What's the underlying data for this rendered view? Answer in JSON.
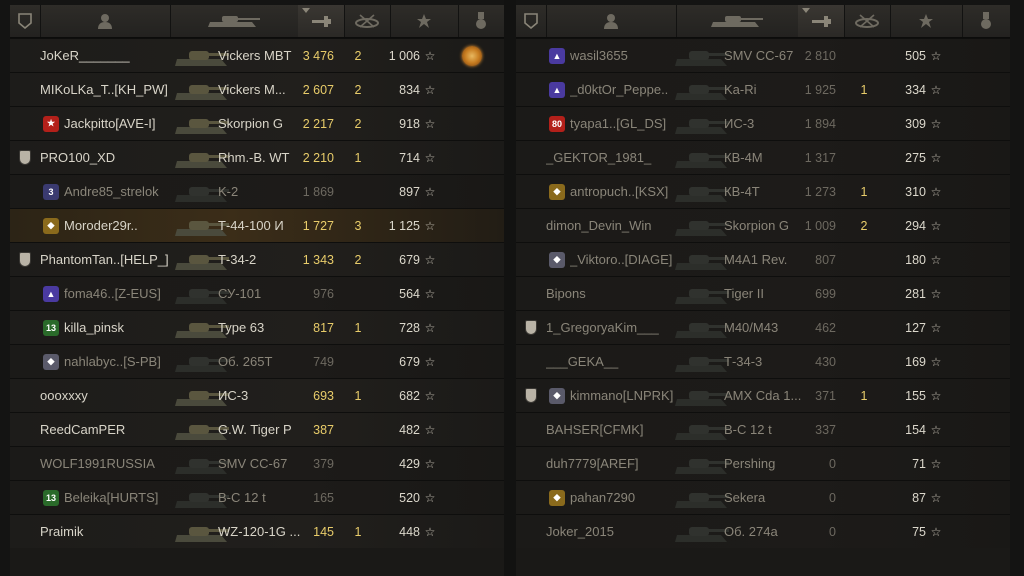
{
  "left_team": {
    "players": [
      {
        "name": "JoKeR_______",
        "tank": "Vickers MBT",
        "dmg": "3 476",
        "kills": "2",
        "xp": "1 006",
        "platoon": false,
        "badge": null,
        "medal": true,
        "dim": false,
        "me": false,
        "dmg_color": "yellow"
      },
      {
        "name": "MIKoLKa_T..[KH_PW]",
        "tank": "Vickers M...",
        "dmg": "2 607",
        "kills": "2",
        "xp": "834",
        "platoon": false,
        "badge": null,
        "medal": false,
        "dim": false,
        "me": false,
        "dmg_color": "yellow"
      },
      {
        "name": "Jackpitto[AVE-I]",
        "tank": "Skorpion G",
        "dmg": "2 217",
        "kills": "2",
        "xp": "918",
        "platoon": false,
        "badge": "star-badge",
        "medal": false,
        "dim": false,
        "me": false,
        "dmg_color": "yellow"
      },
      {
        "name": "PRO100_XD",
        "tank": "Rhm.-B. WT",
        "dmg": "2 210",
        "kills": "1",
        "xp": "714",
        "platoon": true,
        "badge": null,
        "medal": false,
        "dim": false,
        "me": false,
        "dmg_color": "yellow"
      },
      {
        "name": "Andre85_strelok",
        "tank": "K-2",
        "dmg": "1 869",
        "kills": "",
        "xp": "897",
        "platoon": false,
        "badge": "rank-3-badge",
        "medal": false,
        "dim": true,
        "me": false,
        "dmg_color": "grey"
      },
      {
        "name": "Moroder29r..",
        "tank": "Т-44-100 И",
        "dmg": "1 727",
        "kills": "3",
        "xp": "1 125",
        "platoon": false,
        "badge": "gold-badge",
        "medal": false,
        "dim": false,
        "me": true,
        "dmg_color": "yellow"
      },
      {
        "name": "PhantomTan..[HELP_]",
        "tank": "Т-34-2",
        "dmg": "1 343",
        "kills": "2",
        "xp": "679",
        "platoon": true,
        "badge": null,
        "medal": false,
        "dim": false,
        "me": false,
        "dmg_color": "yellow"
      },
      {
        "name": "foma46..[Z-EUS]",
        "tank": "СУ-101",
        "dmg": "976",
        "kills": "",
        "xp": "564",
        "platoon": false,
        "badge": "clan-badge",
        "medal": false,
        "dim": true,
        "me": false,
        "dmg_color": "grey"
      },
      {
        "name": "killa_pinsk",
        "tank": "Type 63",
        "dmg": "817",
        "kills": "1",
        "xp": "728",
        "platoon": false,
        "badge": "rank-13-badge",
        "medal": false,
        "dim": false,
        "me": false,
        "dmg_color": "yellow"
      },
      {
        "name": "nahlabyc..[S-PB]",
        "tank": "Об. 265Т",
        "dmg": "749",
        "kills": "",
        "xp": "679",
        "platoon": false,
        "badge": "diamond-badge",
        "medal": false,
        "dim": true,
        "me": false,
        "dmg_color": "grey"
      },
      {
        "name": "oooxxxy",
        "tank": "ИС-3",
        "dmg": "693",
        "kills": "1",
        "xp": "682",
        "platoon": false,
        "badge": null,
        "medal": false,
        "dim": false,
        "me": false,
        "dmg_color": "yellow"
      },
      {
        "name": "ReedCamPER",
        "tank": "G.W. Tiger P",
        "dmg": "387",
        "kills": "",
        "xp": "482",
        "platoon": false,
        "badge": null,
        "medal": false,
        "dim": false,
        "me": false,
        "dmg_color": "yellow"
      },
      {
        "name": "WOLF1991RUSSIA",
        "tank": "SMV CC-67",
        "dmg": "379",
        "kills": "",
        "xp": "429",
        "platoon": false,
        "badge": null,
        "medal": false,
        "dim": true,
        "me": false,
        "dmg_color": "grey"
      },
      {
        "name": "Beleika[HURTS]",
        "tank": "В-С 12 t",
        "dmg": "165",
        "kills": "",
        "xp": "520",
        "platoon": false,
        "badge": "rank-13-badge",
        "medal": false,
        "dim": true,
        "me": false,
        "dmg_color": "grey"
      },
      {
        "name": "Praimik",
        "tank": "WZ-120-1G ...",
        "dmg": "145",
        "kills": "1",
        "xp": "448",
        "platoon": false,
        "badge": null,
        "medal": false,
        "dim": false,
        "me": false,
        "dmg_color": "yellow"
      }
    ]
  },
  "right_team": {
    "players": [
      {
        "name": "wasil3655",
        "tank": "SMV CC-67",
        "dmg": "2 810",
        "kills": "",
        "xp": "505",
        "platoon": false,
        "badge": "clan-badge",
        "dim": true,
        "dmg_color": "grey"
      },
      {
        "name": "_d0ktOr_Peppe..",
        "tank": "Ka-Ri",
        "dmg": "1 925",
        "kills": "1",
        "xp": "334",
        "platoon": false,
        "badge": "clan-badge",
        "dim": true,
        "dmg_color": "grey"
      },
      {
        "name": "tyapa1..[GL_DS]",
        "tank": "ИС-3",
        "dmg": "1 894",
        "kills": "",
        "xp": "309",
        "platoon": false,
        "badge": "red-badge",
        "dim": true,
        "dmg_color": "grey"
      },
      {
        "name": "_GEKTOR_1981_",
        "tank": "КВ-4М",
        "dmg": "1 317",
        "kills": "",
        "xp": "275",
        "platoon": false,
        "badge": null,
        "dim": true,
        "dmg_color": "grey"
      },
      {
        "name": "antropuch..[KSX]",
        "tank": "КВ-4Т",
        "dmg": "1 273",
        "kills": "1",
        "xp": "310",
        "platoon": false,
        "badge": "gold-badge",
        "dim": true,
        "dmg_color": "grey"
      },
      {
        "name": "dimon_Devin_Win",
        "tank": "Skorpion G",
        "dmg": "1 009",
        "kills": "2",
        "xp": "294",
        "platoon": false,
        "badge": null,
        "dim": true,
        "dmg_color": "grey"
      },
      {
        "name": "_Viktoro..[DIAGE]",
        "tank": "M4A1 Rev.",
        "dmg": "807",
        "kills": "",
        "xp": "180",
        "platoon": false,
        "badge": "diamond-badge",
        "dim": true,
        "dmg_color": "grey"
      },
      {
        "name": "Bipons",
        "tank": "Tiger II",
        "dmg": "699",
        "kills": "",
        "xp": "281",
        "platoon": false,
        "badge": null,
        "dim": true,
        "dmg_color": "grey"
      },
      {
        "name": "1_GregoryaKim___",
        "tank": "M40/M43",
        "dmg": "462",
        "kills": "",
        "xp": "127",
        "platoon": true,
        "badge": null,
        "dim": true,
        "dmg_color": "grey"
      },
      {
        "name": "___GEKA__",
        "tank": "Т-34-3",
        "dmg": "430",
        "kills": "",
        "xp": "169",
        "platoon": false,
        "badge": null,
        "dim": true,
        "dmg_color": "grey"
      },
      {
        "name": "kimmano[LNPRK]",
        "tank": "AMX Cda 1...",
        "dmg": "371",
        "kills": "1",
        "xp": "155",
        "platoon": true,
        "badge": "diamond-badge",
        "dim": true,
        "dmg_color": "grey"
      },
      {
        "name": "BAHSER[CFMK]",
        "tank": "В-С 12 t",
        "dmg": "337",
        "kills": "",
        "xp": "154",
        "platoon": false,
        "badge": null,
        "dim": true,
        "dmg_color": "grey"
      },
      {
        "name": "duh7779[AREF]",
        "tank": "Pershing",
        "dmg": "0",
        "kills": "",
        "xp": "71",
        "platoon": false,
        "badge": null,
        "dim": true,
        "dmg_color": "grey"
      },
      {
        "name": "pahan7290",
        "tank": "Sekera",
        "dmg": "0",
        "kills": "",
        "xp": "87",
        "platoon": false,
        "badge": "gold-badge",
        "dim": true,
        "dmg_color": "grey"
      },
      {
        "name": "Joker_2015",
        "tank": "Об. 274а",
        "dmg": "0",
        "kills": "",
        "xp": "75",
        "platoon": false,
        "badge": null,
        "dim": true,
        "dmg_color": "grey"
      }
    ]
  },
  "star_glyph": "☆",
  "colors": {
    "damage_highlight": "#e8cc6a",
    "dim_text": "#8a8579",
    "accent_gold": "#c77c20"
  }
}
